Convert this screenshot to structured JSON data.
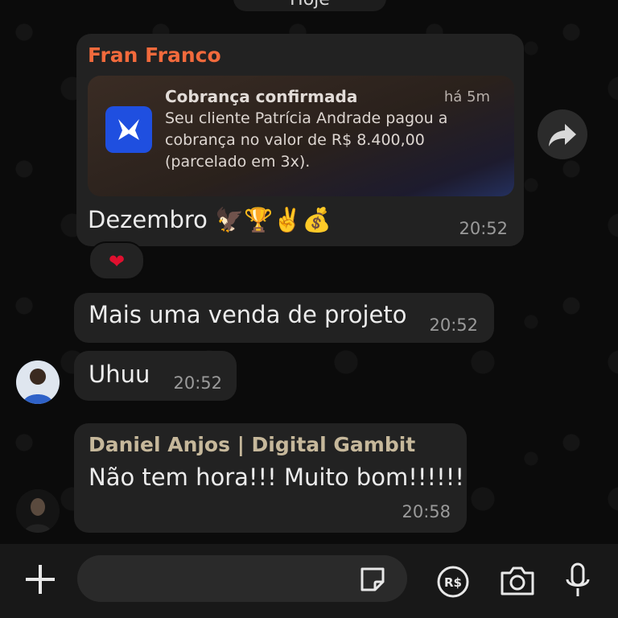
{
  "date_label": "Hoje",
  "messages": [
    {
      "sender": "Fran Franco",
      "notification": {
        "title": "Cobrança confirmada",
        "ago": "há 5m",
        "body": "Seu cliente Patrícia Andrade pagou a cobrança no valor de R$ 8.400,00 (parcelado em 3x)."
      },
      "text": "Dezembro 🦅🏆✌️💰",
      "time": "20:52",
      "reaction": "❤"
    },
    {
      "text": "Mais uma venda de projeto",
      "time": "20:52"
    },
    {
      "text": "Uhuu",
      "time": "20:52"
    },
    {
      "sender": "Daniel Anjos | Digital Gambit",
      "text": "Não tem hora!!! Muito bom!!!!!!",
      "time": "20:58"
    }
  ],
  "composer": {
    "placeholder": "",
    "icons": [
      "plus-icon",
      "sticker-icon",
      "pix-payment-icon",
      "camera-icon",
      "microphone-icon"
    ]
  },
  "colors": {
    "background": "#0b0b0b",
    "bubble": "#222222",
    "sender1": "#f26a3c",
    "sender2": "#c6b89b",
    "app_icon": "#1f4fe0"
  }
}
